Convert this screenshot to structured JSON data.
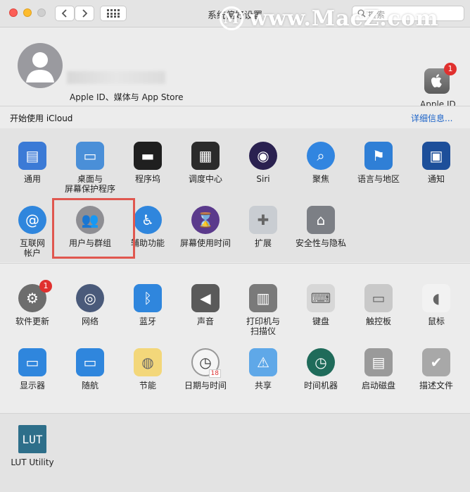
{
  "window": {
    "title": "系统偏好设置",
    "search_placeholder": "搜索"
  },
  "watermark": {
    "text": "www.MacZ.com",
    "logo_glyph": "M"
  },
  "account": {
    "subtitle": "Apple ID、媒体与 App Store",
    "apple_id_label": "Apple ID",
    "badge": "1"
  },
  "icloud": {
    "prompt": "开始使用 iCloud",
    "details_link": "详细信息..."
  },
  "row1": [
    {
      "label": "通用",
      "icon": "general-icon",
      "color": "#3b7ad6"
    },
    {
      "label": "桌面与\n屏幕保护程序",
      "icon": "desktop-screensaver-icon",
      "color": "#4a8fd8"
    },
    {
      "label": "程序坞",
      "icon": "dock-icon",
      "color": "#1f1f1f"
    },
    {
      "label": "调度中心",
      "icon": "mission-control-icon",
      "color": "#2b2b2b"
    },
    {
      "label": "Siri",
      "icon": "siri-icon",
      "color": "#2a2150"
    },
    {
      "label": "聚焦",
      "icon": "spotlight-icon",
      "color": "#3185e0"
    },
    {
      "label": "语言与地区",
      "icon": "language-region-icon",
      "color": "#2f7fd6"
    },
    {
      "label": "通知",
      "icon": "notifications-icon",
      "color": "#1d4f9a"
    }
  ],
  "row2": [
    {
      "label": "互联网\n帐户",
      "icon": "internet-accounts-icon",
      "color": "#2f86dd"
    },
    {
      "label": "用户与群组",
      "icon": "users-groups-icon",
      "color": "#8e8e93"
    },
    {
      "label": "辅助功能",
      "icon": "accessibility-icon",
      "color": "#2f86dd"
    },
    {
      "label": "屏幕使用时间",
      "icon": "screen-time-icon",
      "color": "#5b3a8c"
    },
    {
      "label": "扩展",
      "icon": "extensions-icon",
      "color": "#c9cdd2"
    },
    {
      "label": "安全性与隐私",
      "icon": "security-privacy-icon",
      "color": "#7c7f85"
    }
  ],
  "row3": [
    {
      "label": "软件更新",
      "icon": "software-update-icon",
      "color": "#6d6d6d",
      "badge": "1"
    },
    {
      "label": "网络",
      "icon": "network-icon",
      "color": "#4a5a7a"
    },
    {
      "label": "蓝牙",
      "icon": "bluetooth-icon",
      "color": "#2f86dd"
    },
    {
      "label": "声音",
      "icon": "sound-icon",
      "color": "#5a5a5a"
    },
    {
      "label": "打印机与\n扫描仪",
      "icon": "printers-scanners-icon",
      "color": "#7a7a7a"
    },
    {
      "label": "键盘",
      "icon": "keyboard-icon",
      "color": "#d7d7d7"
    },
    {
      "label": "触控板",
      "icon": "trackpad-icon",
      "color": "#c9c9c9"
    },
    {
      "label": "鼠标",
      "icon": "mouse-icon",
      "color": "#f2f2f2"
    }
  ],
  "row4": [
    {
      "label": "显示器",
      "icon": "displays-icon",
      "color": "#2f86dd"
    },
    {
      "label": "随航",
      "icon": "sidecar-icon",
      "color": "#2f86dd"
    },
    {
      "label": "节能",
      "icon": "energy-saver-icon",
      "color": "#f3d77a"
    },
    {
      "label": "日期与时间",
      "icon": "date-time-icon",
      "color": "#f5f5f5"
    },
    {
      "label": "共享",
      "icon": "sharing-icon",
      "color": "#5fa8e8"
    },
    {
      "label": "时间机器",
      "icon": "time-machine-icon",
      "color": "#1f6b5a"
    },
    {
      "label": "启动磁盘",
      "icon": "startup-disk-icon",
      "color": "#9a9a9a"
    },
    {
      "label": "描述文件",
      "icon": "profiles-icon",
      "color": "#a8a8a8"
    }
  ],
  "row5": [
    {
      "label": "LUT Utility",
      "icon": "lut-utility-icon",
      "color": "#2e6f8a",
      "glyph": "LUT"
    }
  ],
  "date_icon_day": "18"
}
